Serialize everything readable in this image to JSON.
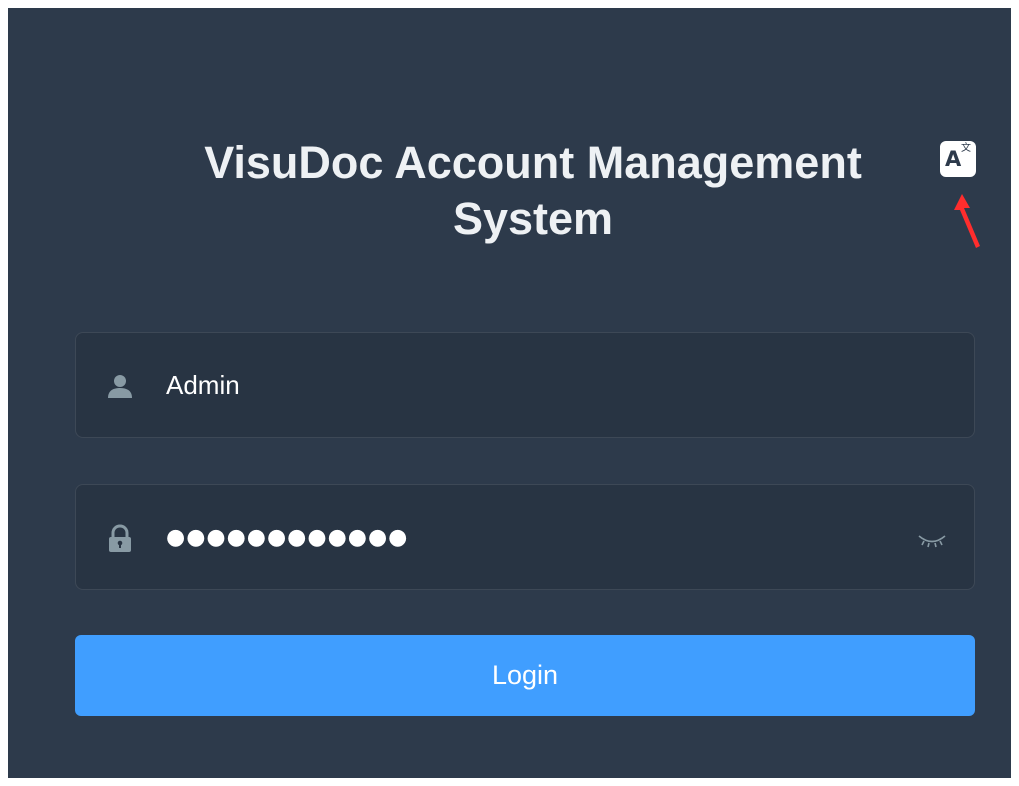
{
  "title": {
    "line1": "VisuDoc Account Management",
    "line2": "System"
  },
  "language_switch": {
    "icon": "translate-icon",
    "glyph_main": "A",
    "glyph_sub": "文"
  },
  "annotation": {
    "icon": "red-arrow-icon",
    "color": "#ff2d2d"
  },
  "username": {
    "icon": "user-icon",
    "value": "Admin"
  },
  "password": {
    "icon": "lock-icon",
    "value": "●●●●●●●●●●●●",
    "toggle_icon": "eye-closed-icon"
  },
  "login_button": {
    "label": "Login"
  },
  "colors": {
    "panel_bg": "#2d3a4b",
    "input_bg": "#283443",
    "primary": "#409eff",
    "icon_gray": "#889aa4",
    "title_text": "#eef1f4"
  }
}
